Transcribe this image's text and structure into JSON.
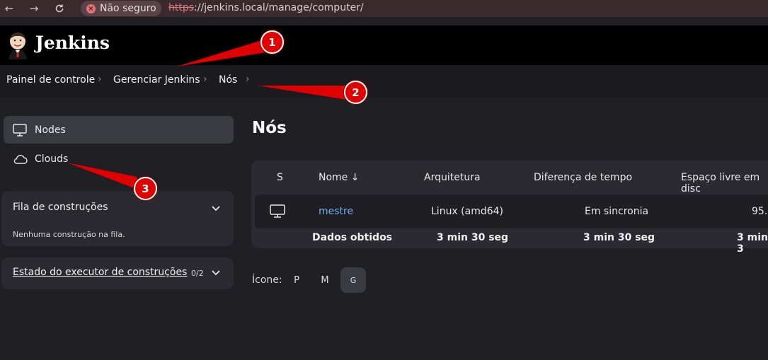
{
  "browser": {
    "security_label": "Não seguro",
    "url_scheme": "https",
    "url_rest": "://jenkins.local/manage/computer/"
  },
  "header": {
    "brand": "Jenkins"
  },
  "breadcrumb": [
    "Painel de controle",
    "Gerenciar Jenkins",
    "Nós"
  ],
  "sidebar": {
    "items": [
      {
        "label": "Nodes",
        "icon": "monitor-icon",
        "active": true
      },
      {
        "label": "Clouds",
        "icon": "cloud-icon",
        "active": false
      }
    ],
    "build_queue": {
      "title": "Fila de construções",
      "empty_text": "Nenhuma construção na fila."
    },
    "executor_status": {
      "title": "Estado do executor de construções",
      "count": "0/2"
    }
  },
  "main": {
    "title": "Nós",
    "table": {
      "headers": [
        "S",
        "Nome ↓",
        "Arquitetura",
        "Diferença de tempo",
        "Espaço livre em disc"
      ],
      "row": {
        "name": "mestre",
        "arch": "Linux (amd64)",
        "time_diff": "Em sincronia",
        "disk": "95.:"
      },
      "footer": {
        "label": "Dados obtidos",
        "arch": "3 min 30 seg",
        "time_diff": "3 min 30 seg",
        "disk": "3 min 3"
      }
    },
    "icon_size": {
      "label": "Ícone:",
      "options": [
        "P",
        "M",
        "G"
      ],
      "selected": "G"
    }
  },
  "annotations": [
    "1",
    "2",
    "3"
  ],
  "colors": {
    "annotation": "#e00000",
    "link": "#6cb4ee"
  }
}
